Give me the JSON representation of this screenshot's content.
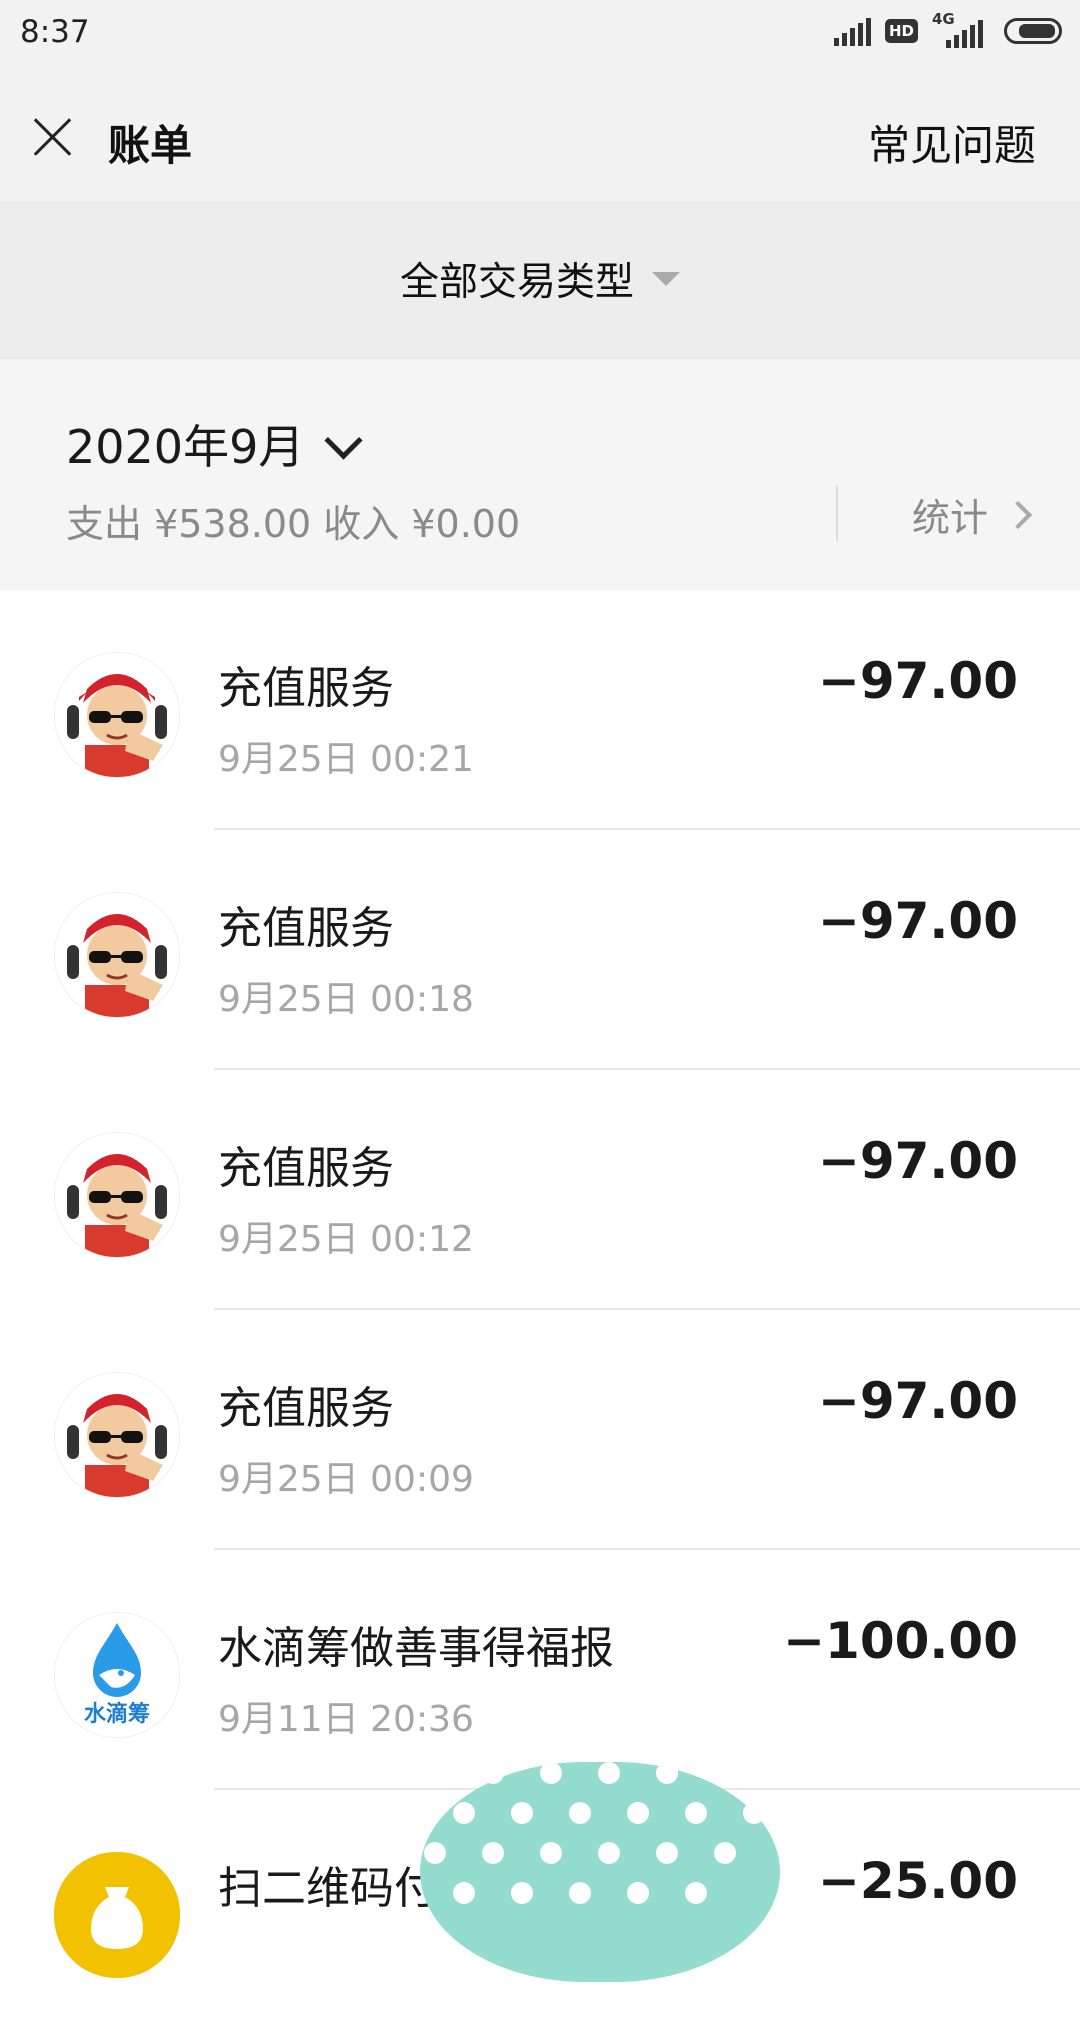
{
  "status_bar": {
    "time": "8:37",
    "hd": "HD",
    "net": "4G"
  },
  "nav": {
    "title": "账单",
    "right_link": "常见问题"
  },
  "filter": {
    "label": "全部交易类型"
  },
  "month": {
    "title": "2020年9月",
    "summary": "支出 ¥538.00 收入 ¥0.00",
    "stats_label": "统计"
  },
  "transactions": [
    {
      "title": "充值服务",
      "time": "9月25日 00:21",
      "amount": "−97.00"
    },
    {
      "title": "充值服务",
      "time": "9月25日 00:18",
      "amount": "−97.00"
    },
    {
      "title": "充值服务",
      "time": "9月25日 00:12",
      "amount": "−97.00"
    },
    {
      "title": "充值服务",
      "time": "9月25日 00:09",
      "amount": "−97.00"
    },
    {
      "title": "水滴筹做善事得福报",
      "time": "9月11日 20:36",
      "amount": "−100.00"
    },
    {
      "title": "扫二维码付",
      "time": "",
      "amount": "−25.00"
    }
  ],
  "logos": {
    "shuidichou": "水滴筹"
  }
}
